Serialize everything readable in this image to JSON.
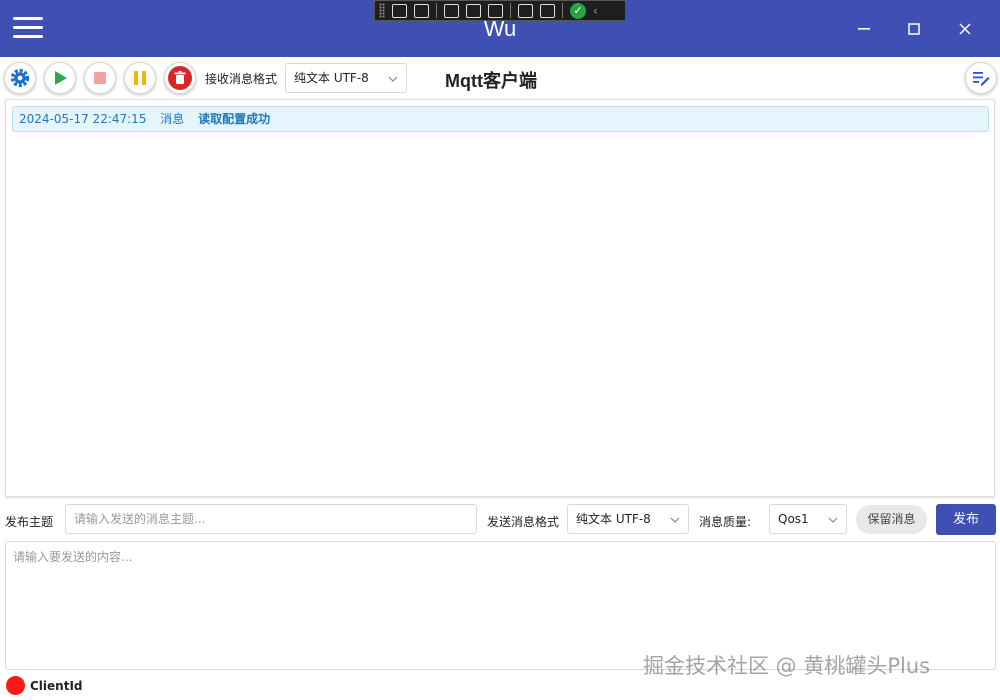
{
  "window": {
    "title": "Wu",
    "minimize_icon": "minimize-icon",
    "maximize_icon": "maximize-icon",
    "close_icon": "close-icon",
    "brand_color": "#3f4fb3"
  },
  "debug_toolbar": {
    "check_icon": "check-icon"
  },
  "toolbar": {
    "icons": [
      "gear-icon",
      "play-icon",
      "stop-icon",
      "pause-icon",
      "trash-icon",
      "edit-notes-icon"
    ],
    "receive_format_label": "接收消息格式",
    "receive_format_value": "纯文本 UTF-8",
    "heading": "Mqtt客户端"
  },
  "log": {
    "entries": [
      {
        "time": "2024-05-17 22:47:15",
        "level": "消息",
        "text": "读取配置成功"
      }
    ]
  },
  "publish": {
    "topic_label": "发布主题",
    "topic_placeholder": "请输入发送的消息主题...",
    "send_format_label": "发送消息格式",
    "send_format_value": "纯文本 UTF-8",
    "qos_label": "消息质量:",
    "qos_value": "Qos1",
    "retain_label": "保留消息",
    "publish_label": "发布",
    "content_placeholder": "请输入要发送的内容..."
  },
  "status": {
    "client_label": "ClientId",
    "dot_color": "#ff1a1a"
  },
  "watermark": "掘金技术社区 @ 黄桃罐头Plus"
}
